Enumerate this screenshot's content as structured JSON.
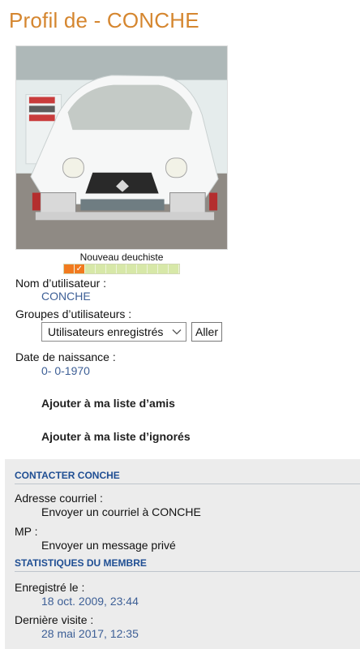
{
  "page": {
    "title": "Profil de - CONCHE"
  },
  "profile": {
    "rank_title": "Nouveau deuchiste",
    "rank_level": {
      "filled": 2,
      "total": 11
    },
    "rank_marker": "✓",
    "username_label": "Nom d’utilisateur :",
    "username": "CONCHE",
    "groups_label": "Groupes d’utilisateurs :",
    "groups_selected": "Utilisateurs enregistrés",
    "groups_go": "Aller",
    "birth_label": "Date de naissance :",
    "birth_value": "0- 0-1970",
    "add_friend": "Ajouter à ma liste d’amis",
    "add_ignored": "Ajouter à ma liste d’ignorés"
  },
  "contact": {
    "header": "CONTACTER CONCHE",
    "email_label": "Adresse courriel :",
    "email_link": "Envoyer un courriel à CONCHE",
    "pm_label": "MP :",
    "pm_link": "Envoyer un message privé"
  },
  "stats": {
    "header": "STATISTIQUES DU MEMBRE",
    "registered_label": "Enregistré le :",
    "registered_value": "18 oct. 2009, 23:44",
    "last_visit_label": "Dernière visite :",
    "last_visit_value": "28 mai 2017, 12:35"
  },
  "colors": {
    "title": "#d5862f",
    "link_blue": "#3d5f96",
    "section_header": "#1f4e93",
    "rank_filled": "#f17a1f",
    "rank_empty": "#d7e8a8",
    "panel_bg": "#ececec"
  }
}
